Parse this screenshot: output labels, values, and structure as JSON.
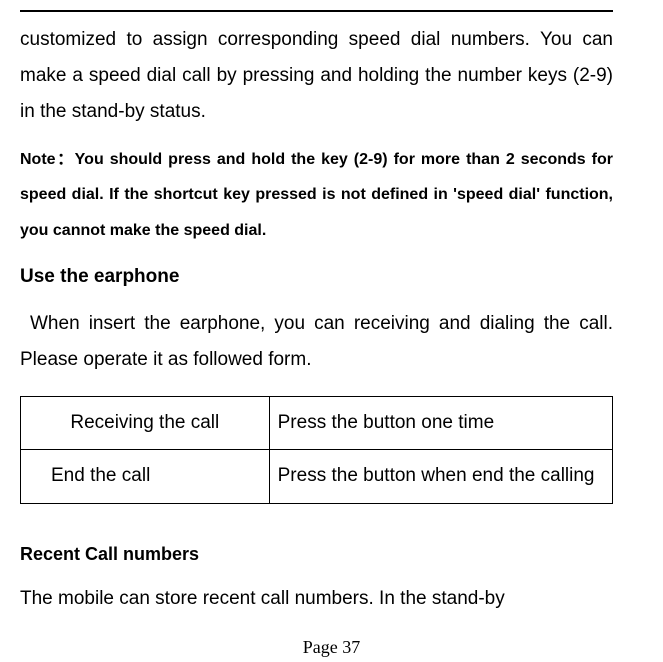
{
  "para1": "customized to assign corresponding speed dial numbers. You can make a speed dial call by pressing and holding the number keys (2-9) in the stand-by status.",
  "note": "Note：You should press and hold the key (2-9) for more than 2 seconds for speed dial. If the shortcut key pressed is not defined in 'speed dial' function, you cannot make the speed dial.",
  "heading1": "Use the earphone",
  "para2": "When insert the earphone, you can receiving and dialing the call. Please operate it as followed form.",
  "table": {
    "rows": [
      {
        "col1": "Receiving the call",
        "col2": "Press the button one time"
      },
      {
        "col1": "End the call",
        "col2": "Press the button when end the calling"
      }
    ]
  },
  "heading2": "Recent Call numbers",
  "para3": "The mobile can store recent call numbers. In the stand-by",
  "footer": "Page 37"
}
